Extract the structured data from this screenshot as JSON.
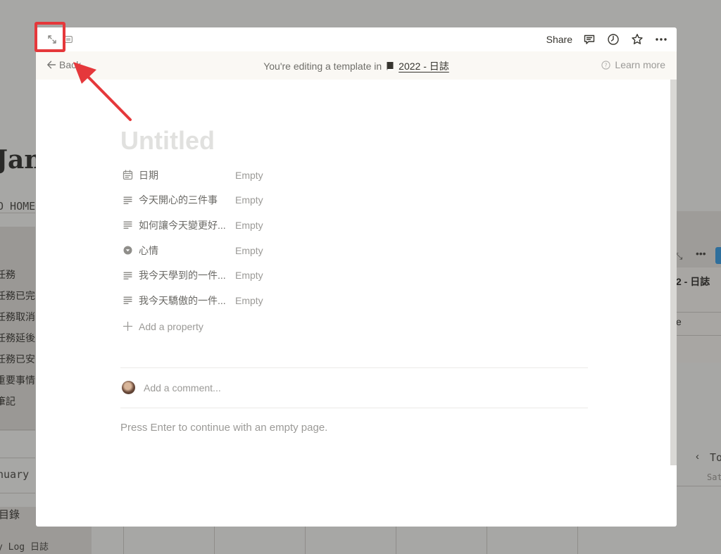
{
  "background": {
    "heading": "Jan",
    "home_link": "O HOME",
    "list_items": [
      "任務",
      "任務已完",
      "任務取消",
      "任務延後",
      "任務已安",
      "重要事情",
      "筆記"
    ],
    "month": "nuary",
    "directory": "目錄",
    "day_log": "y Log 日誌",
    "right_panel_title": "2 - 日誌",
    "right_panel_row": "e",
    "right_nav": "To",
    "right_weekday": "Sat"
  },
  "topbar": {
    "share_label": "Share",
    "icons": [
      "expand-icon",
      "side-peek-icon",
      "comment-icon",
      "clock-icon",
      "star-icon",
      "more-icon"
    ]
  },
  "banner": {
    "back_label": "Back",
    "editing_text": "You're editing a template in",
    "database_name": "2022 - 日誌",
    "learn_more": "Learn more"
  },
  "page": {
    "title_placeholder": "Untitled",
    "properties": [
      {
        "name": "日期",
        "value": "Empty",
        "icon": "calendar-icon"
      },
      {
        "name": "今天開心的三件事",
        "value": "Empty",
        "icon": "text-icon"
      },
      {
        "name": "如何讓今天變更好...",
        "value": "Empty",
        "icon": "text-icon"
      },
      {
        "name": "心情",
        "value": "Empty",
        "icon": "select-icon"
      },
      {
        "name": "我今天學到的一件...",
        "value": "Empty",
        "icon": "text-icon"
      },
      {
        "name": "我今天驕傲的一件...",
        "value": "Empty",
        "icon": "text-icon"
      }
    ],
    "add_property": "Add a property",
    "comment_placeholder": "Add a comment...",
    "continue_hint": "Press Enter to continue with an empty page."
  },
  "colors": {
    "annotation": "#e5383b",
    "banner_bg": "#faf8f4",
    "overlay": "#a7a7a5"
  }
}
